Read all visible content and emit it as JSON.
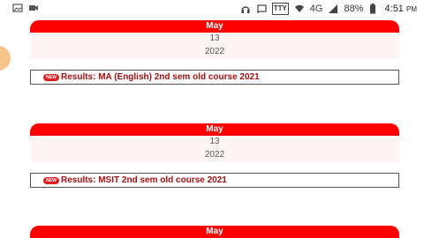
{
  "status_bar": {
    "left_icons": [
      "gallery-icon",
      "video-icon"
    ],
    "right_icons": [
      "headphones-icon",
      "cast-icon",
      "tty-icon",
      "wifi-icon",
      "signal-icon",
      "battery-icon"
    ],
    "tty_label": "TTY",
    "network": "4G",
    "battery": "88%",
    "time": "4:51",
    "time_period": "PM",
    "colors": {
      "text": "#333333"
    }
  },
  "notices": [
    {
      "month": "May",
      "day": "13",
      "year": "2022",
      "badge": "NEW",
      "title": "Results: MA (English) 2nd sem old course 2021"
    },
    {
      "month": "May",
      "day": "13",
      "year": "2022",
      "badge": "NEW",
      "title": "Results: MSIT 2nd sem old course 2021"
    },
    {
      "month": "May"
    }
  ],
  "colors": {
    "date_header": "#ff0000",
    "date_body": "#fff5f5",
    "link": "#a01010",
    "badge": "#e02020"
  }
}
